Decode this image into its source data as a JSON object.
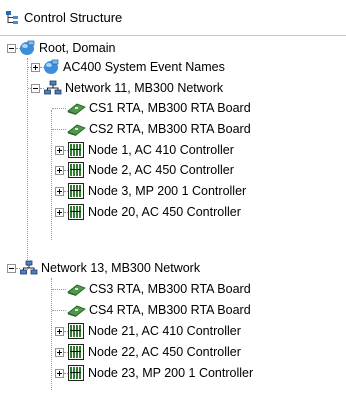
{
  "header": {
    "title": "Control Structure",
    "icon": "structure-tree-icon"
  },
  "tree": {
    "root": {
      "label": "Root, Domain",
      "icon": "domain-globe-icon",
      "expanded": true
    },
    "system_events": {
      "label": "AC400 System Event Names",
      "icon": "domain-globe-icon",
      "expanded": false
    },
    "network11": {
      "label": "Network 11, MB300 Network",
      "icon": "network-icon",
      "expanded": true,
      "rta": [
        "CS1 RTA, MB300 RTA Board",
        "CS2 RTA, MB300 RTA Board"
      ],
      "nodes": [
        "Node 1, AC 410 Controller",
        "Node 2, AC 450 Controller",
        "Node 3, MP 200 1 Controller",
        "Node 20, AC 450 Controller"
      ]
    },
    "network13": {
      "label": "Network 13, MB300 Network",
      "icon": "network-icon",
      "expanded": true,
      "rta": [
        "CS3 RTA, MB300 RTA Board",
        "CS4 RTA, MB300 RTA Board"
      ],
      "nodes": [
        "Node 21, AC 410 Controller",
        "Node 22, AC 450 Controller",
        "Node 23, MP 200 1 Controller"
      ]
    }
  },
  "colors": {
    "globe": "#3a8fd8",
    "rta_board": "#4f9a4a",
    "controller": "#2f7d2f",
    "tree_lines": "#9a9a9a"
  }
}
